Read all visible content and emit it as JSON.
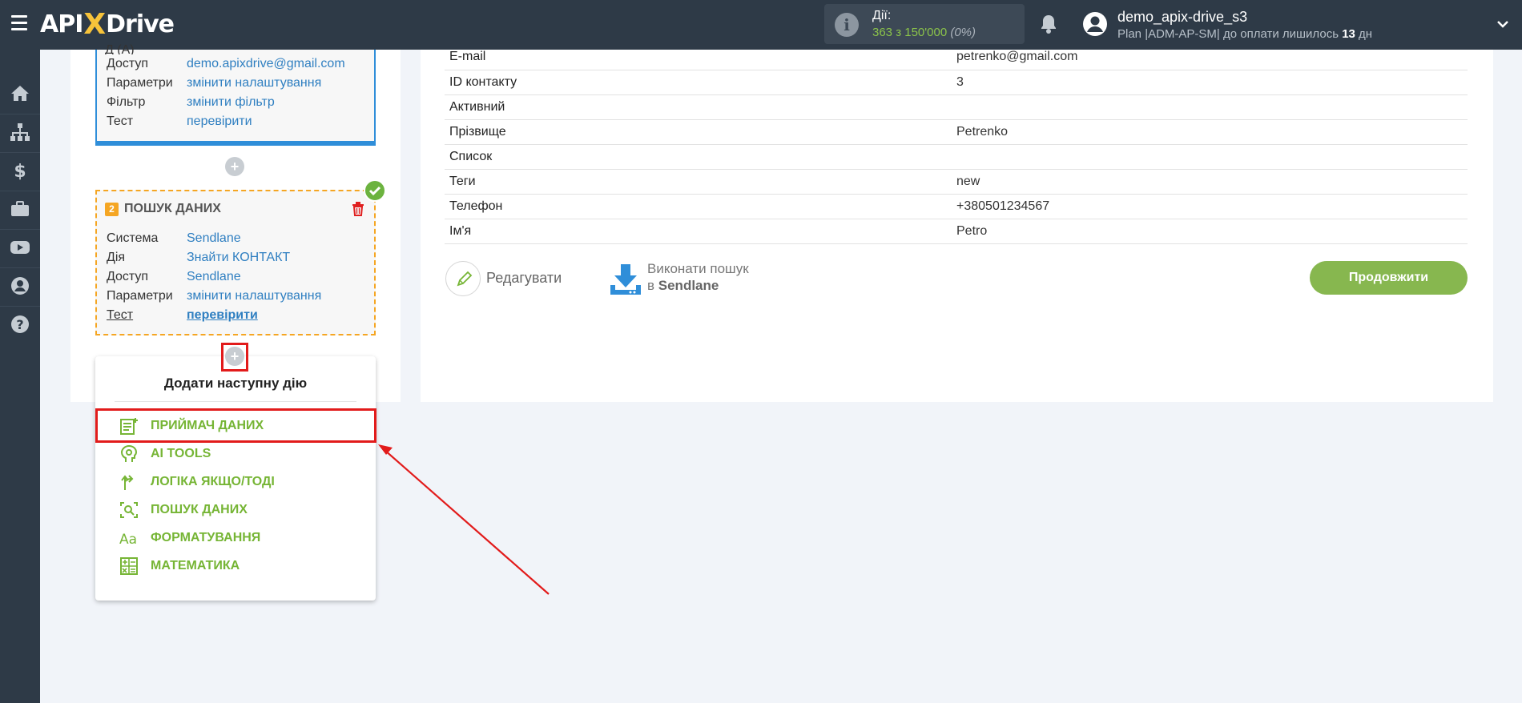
{
  "header": {
    "logo_prefix": "API",
    "logo_x": "X",
    "logo_suffix": "Drive",
    "actions_label": "Дії:",
    "actions_count": "363 з 150'000",
    "actions_percent": "(0%)",
    "user_name": "demo_apix-drive_s3",
    "plan_prefix": "Plan |ADM-AP-SM| до оплати лишилось",
    "plan_days": "13",
    "plan_suffix": "дн"
  },
  "sidebar": {
    "icons": [
      "home-icon",
      "sitemap-icon",
      "dollar-icon",
      "briefcase-icon",
      "youtube-icon",
      "user-circle-icon",
      "help-icon"
    ]
  },
  "card1": {
    "clipped_text": "Д                                   (A)",
    "rows": [
      {
        "label": "Доступ",
        "value": "demo.apixdrive@gmail.com"
      },
      {
        "label": "Параметри",
        "value": "змінити налаштування"
      },
      {
        "label": "Фільтр",
        "value": "змінити фільтр"
      },
      {
        "label": "Тест",
        "value": "перевірити"
      }
    ]
  },
  "card2": {
    "number": "2",
    "title": "ПОШУК ДАНИХ",
    "rows": [
      {
        "label": "Система",
        "value": "Sendlane"
      },
      {
        "label": "Дія",
        "value": "Знайти КОНТАКТ"
      },
      {
        "label": "Доступ",
        "value": "Sendlane"
      },
      {
        "label": "Параметри",
        "value": "змінити налаштування"
      },
      {
        "label": "Тест",
        "value": "перевірити"
      }
    ]
  },
  "plus_label": "+",
  "dropdown": {
    "title": "Додати наступну дію",
    "items": [
      {
        "label": "ПРИЙМАЧ ДАНИХ",
        "icon": "receiver-icon"
      },
      {
        "label": "AI TOOLS",
        "icon": "ai-head-icon"
      },
      {
        "label": "ЛОГІКА ЯКЩО/ТОДІ",
        "icon": "branch-icon"
      },
      {
        "label": "ПОШУК ДАНИХ",
        "icon": "search-data-icon"
      },
      {
        "label": "ФОРМАТУВАННЯ",
        "icon": "format-icon"
      },
      {
        "label": "МАТЕМАТИКА",
        "icon": "math-icon"
      }
    ]
  },
  "table": {
    "rows": [
      {
        "field": "E-mail",
        "value": "petrenko@gmail.com"
      },
      {
        "field": "ID контакту",
        "value": "3"
      },
      {
        "field": "Активний",
        "value": ""
      },
      {
        "field": "Прізвище",
        "value": "Petrenko"
      },
      {
        "field": "Список",
        "value": ""
      },
      {
        "field": "Теги",
        "value": "new"
      },
      {
        "field": "Телефон",
        "value": "+380501234567"
      },
      {
        "field": "Ім'я",
        "value": "Petro"
      }
    ]
  },
  "actions_bar": {
    "edit_label": "Редагувати",
    "search_line1": "Виконати пошук",
    "search_in": "в",
    "search_system": "Sendlane",
    "continue_label": "Продовжити"
  },
  "colors": {
    "topbar": "#2e3a47",
    "accent_green": "#76b535",
    "link_blue": "#2f7fc1",
    "highlight_red": "#e21b1b",
    "orange": "#f5a623"
  }
}
